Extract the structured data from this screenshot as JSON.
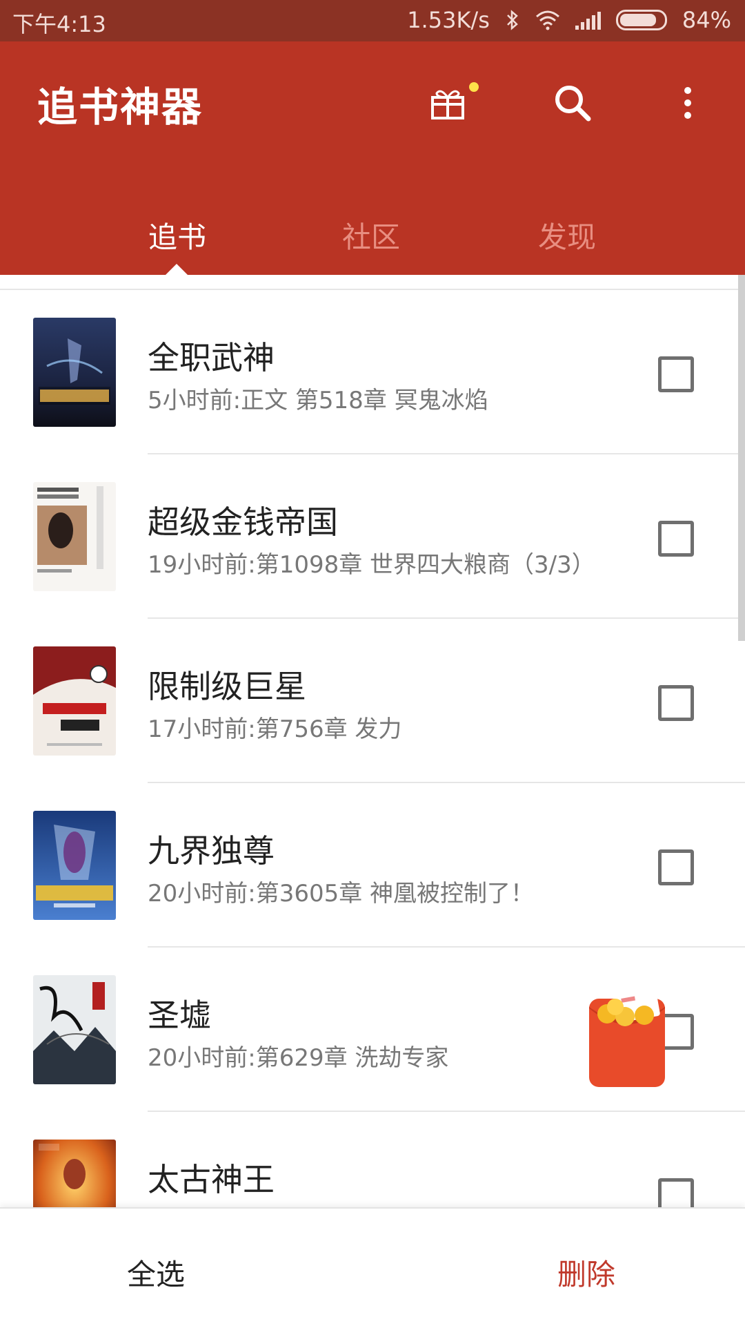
{
  "status_bar": {
    "time": "下午4:13",
    "net_speed": "1.53K/s",
    "battery": "84%"
  },
  "app_bar": {
    "logo": "追书神器",
    "tabs": [
      {
        "label": "追书",
        "active": true
      },
      {
        "label": "社区",
        "active": false
      },
      {
        "label": "发现",
        "active": false
      }
    ],
    "icons": [
      "gift-icon",
      "search-icon",
      "more-vert-icon"
    ]
  },
  "books": [
    {
      "title": "全职武神",
      "subtitle": "5小时前:正文 第518章  冥鬼冰焰",
      "checked": false
    },
    {
      "title": "超级金钱帝国",
      "subtitle": "19小时前:第1098章 世界四大粮商（3/3）",
      "checked": false
    },
    {
      "title": "限制级巨星",
      "subtitle": "17小时前:第756章 发力",
      "checked": false
    },
    {
      "title": "九界独尊",
      "subtitle": "20小时前:第3605章    神凰被控制了！",
      "checked": false
    },
    {
      "title": "圣墟",
      "subtitle": "20小时前:第629章 洗劫专家",
      "checked": false
    },
    {
      "title": "太古神王",
      "subtitle": "",
      "checked": false
    }
  ],
  "bottom_bar": {
    "select_all": "全选",
    "delete": "删除"
  },
  "colors": {
    "primary": "#b93424",
    "status_bar": "#8b3224",
    "delete_text": "#c0392b"
  }
}
